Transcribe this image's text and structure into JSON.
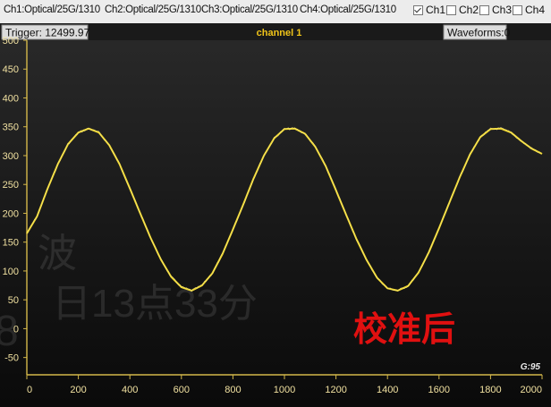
{
  "header": {
    "channels": [
      "Ch1:Optical/25G/1310",
      "Ch2:Optical/25G/1310",
      "Ch3:Optical/25G/1310",
      "Ch4:Optical/25G/1310"
    ],
    "checkboxes": [
      {
        "label": "Ch1",
        "checked": true
      },
      {
        "label": "Ch2",
        "checked": false
      },
      {
        "label": "Ch3",
        "checked": false
      },
      {
        "label": "Ch4",
        "checked": false
      }
    ]
  },
  "scope": {
    "trigger": "Trigger: 12499.97",
    "channel_title": "channel 1",
    "waveforms": "Waveforms:0",
    "corner_label": "G:95",
    "annotation": "校准后",
    "watermark": [
      "波",
      "日13点33分",
      "8"
    ]
  },
  "colors": {
    "trace": "#f0d832",
    "axis": "#d4b84a",
    "annotation": "#e01010"
  },
  "chart_data": {
    "type": "line",
    "title": "channel 1",
    "xlim": [
      0,
      2000
    ],
    "ylim": [
      -80,
      500
    ],
    "x_ticks": [
      0,
      200,
      400,
      600,
      800,
      1000,
      1200,
      1400,
      1600,
      1800,
      2000
    ],
    "y_ticks": [
      500,
      450,
      400,
      350,
      300,
      250,
      200,
      150,
      100,
      50,
      0,
      -50
    ],
    "series": [
      {
        "x": [
          0,
          40,
          80,
          120,
          160,
          200,
          240,
          280,
          320,
          360,
          400,
          440,
          480,
          520,
          560,
          600,
          640,
          680,
          720,
          760,
          800,
          840,
          880,
          920,
          960,
          1000,
          1040,
          1080,
          1120,
          1160,
          1200,
          1240,
          1280,
          1320,
          1360,
          1400,
          1440,
          1480,
          1520,
          1560,
          1600,
          1640,
          1680,
          1720,
          1760,
          1800,
          1840,
          1880,
          1920,
          1960,
          2000
        ],
        "y": [
          165,
          195,
          242,
          285,
          320,
          340,
          347,
          340,
          318,
          285,
          243,
          200,
          158,
          120,
          90,
          72,
          66,
          75,
          96,
          130,
          172,
          215,
          260,
          300,
          330,
          346,
          347,
          338,
          315,
          282,
          240,
          197,
          155,
          118,
          88,
          70,
          66,
          74,
          97,
          132,
          174,
          218,
          262,
          302,
          332,
          346,
          347,
          340,
          325,
          312,
          303
        ]
      }
    ]
  }
}
